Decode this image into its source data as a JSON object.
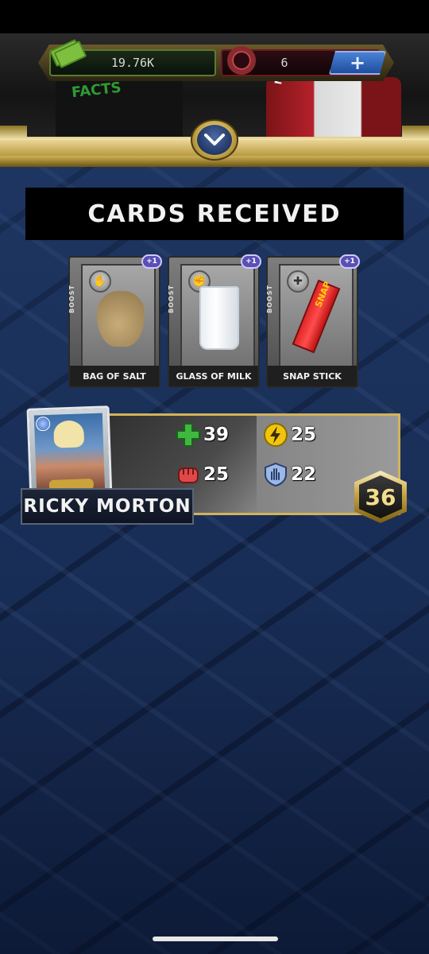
{
  "currency": {
    "cash": "19.76K",
    "tokens": "6",
    "add_label": "+"
  },
  "background_shirts": {
    "left_text": "FACTS",
    "right_text": "NEW"
  },
  "title": "CARDS RECEIVED",
  "cards": [
    {
      "name": "BAG OF SALT",
      "type": "BOOST",
      "count": "+1",
      "icon": "hand-icon"
    },
    {
      "name": "GLASS OF MILK",
      "type": "BOOST",
      "count": "+1",
      "icon": "fist-icon"
    },
    {
      "name": "SNAP STICK",
      "type": "BOOST",
      "count": "+1",
      "icon": "plus-icon",
      "snap_text": "SNAP"
    }
  ],
  "wrestler": {
    "name": "RICKY MORTON",
    "level": "36",
    "stats": {
      "health": "39",
      "power": "25",
      "strike": "25",
      "defense": "22"
    }
  },
  "colors": {
    "gold": "#d2b35a",
    "health": "#3fb83f",
    "power": "#f1c40f",
    "strike": "#e04848",
    "defense": "#9bb8e8"
  }
}
